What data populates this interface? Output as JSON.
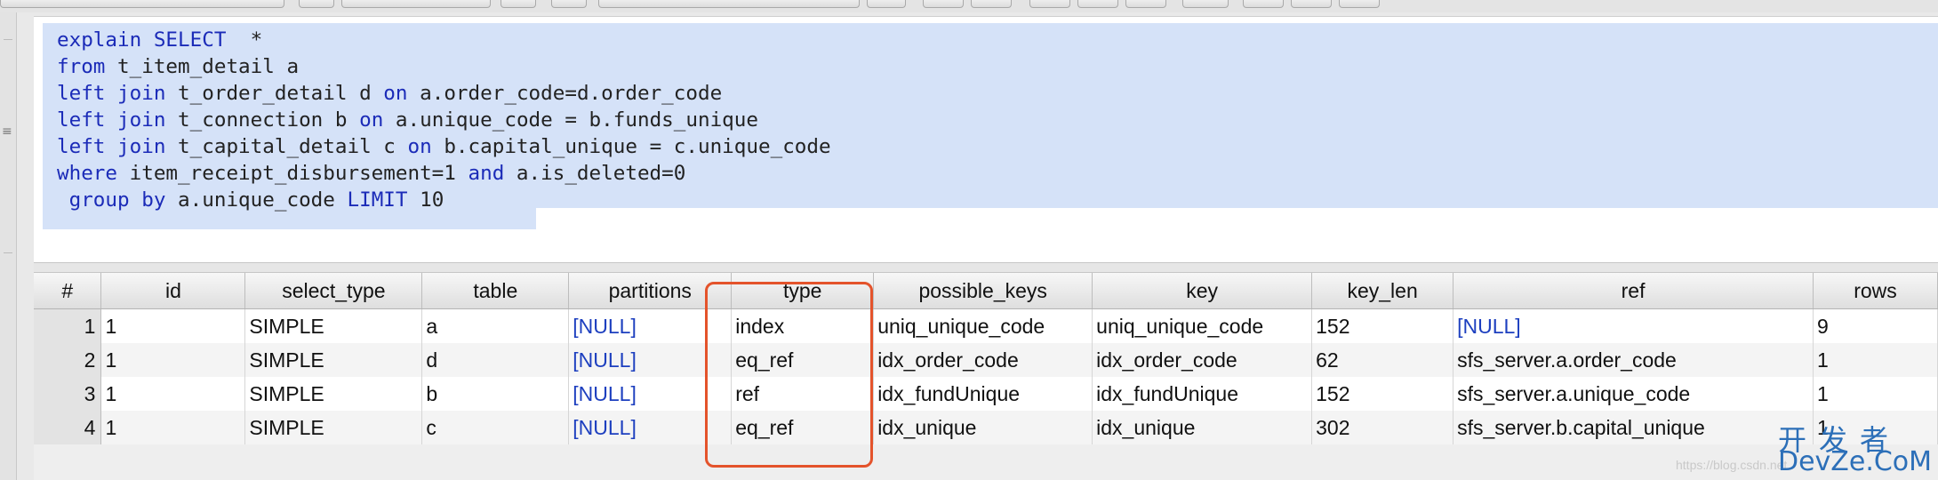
{
  "editor": {
    "sql_lines": [
      [
        {
          "t": "explain SELECT",
          "kw": true
        },
        {
          "t": "  *",
          "kw": false
        }
      ],
      [
        {
          "t": "from",
          "kw": true
        },
        {
          "t": " t_item_detail a",
          "kw": false
        }
      ],
      [
        {
          "t": "left join",
          "kw": true
        },
        {
          "t": " t_order_detail d ",
          "kw": false
        },
        {
          "t": "on",
          "kw": true
        },
        {
          "t": " a.order_code=d.order_code",
          "kw": false
        }
      ],
      [
        {
          "t": "left join",
          "kw": true
        },
        {
          "t": " t_connection b ",
          "kw": false
        },
        {
          "t": "on",
          "kw": true
        },
        {
          "t": " a.unique_code = b.funds_unique",
          "kw": false
        }
      ],
      [
        {
          "t": "left join",
          "kw": true
        },
        {
          "t": " t_capital_detail c ",
          "kw": false
        },
        {
          "t": "on",
          "kw": true
        },
        {
          "t": " b.capital_unique = c.unique_code",
          "kw": false
        }
      ],
      [
        {
          "t": "where",
          "kw": true
        },
        {
          "t": " item_receipt_disbursement=1 ",
          "kw": false
        },
        {
          "t": "and",
          "kw": true
        },
        {
          "t": " a.is_deleted=0",
          "kw": false
        }
      ],
      [
        {
          "t": " group by",
          "kw": true
        },
        {
          "t": " a.unique_code ",
          "kw": false
        },
        {
          "t": "LIMIT",
          "kw": true
        },
        {
          "t": " 10",
          "kw": false
        }
      ]
    ]
  },
  "results": {
    "columns": [
      "#",
      "id",
      "select_type",
      "table",
      "partitions",
      "type",
      "possible_keys",
      "key",
      "key_len",
      "ref",
      "rows"
    ],
    "rows": [
      [
        "1",
        "1",
        "SIMPLE",
        "a",
        "[NULL]",
        "index",
        "uniq_unique_code",
        "uniq_unique_code",
        "152",
        "[NULL]",
        "9"
      ],
      [
        "2",
        "1",
        "SIMPLE",
        "d",
        "[NULL]",
        "eq_ref",
        "idx_order_code",
        "idx_order_code",
        "62",
        "sfs_server.a.order_code",
        "1"
      ],
      [
        "3",
        "1",
        "SIMPLE",
        "b",
        "[NULL]",
        "ref",
        "idx_fundUnique",
        "idx_fundUnique",
        "152",
        "sfs_server.a.unique_code",
        "1"
      ],
      [
        "4",
        "1",
        "SIMPLE",
        "c",
        "[NULL]",
        "eq_ref",
        "idx_unique",
        "idx_unique",
        "302",
        "sfs_server.b.capital_unique",
        "1"
      ]
    ]
  },
  "watermark": {
    "zh": "开发者",
    "en": "DevZe.CoM",
    "faint": "https://blog.csdn.net"
  },
  "colors": {
    "selection": "#d5e2f8",
    "keyword": "#1b2bb8",
    "null_value": "#1d3fbf",
    "highlight_box": "#e4532b",
    "watermark": "#2c6fb8"
  }
}
